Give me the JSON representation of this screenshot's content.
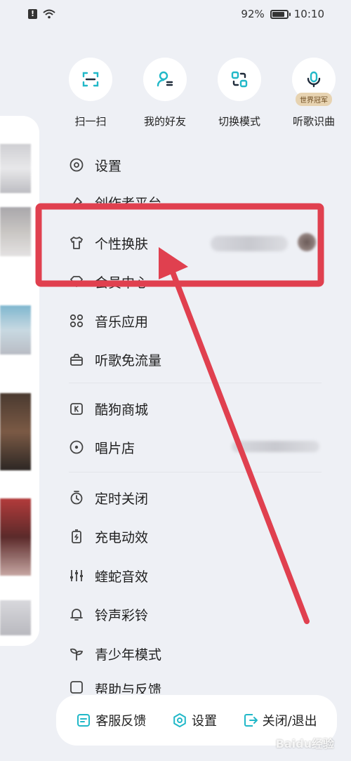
{
  "status_bar": {
    "battery": "92%",
    "time": "10:10"
  },
  "quick_actions": [
    {
      "label": "扫一扫",
      "icon": "scan-icon"
    },
    {
      "label": "我的好友",
      "icon": "friends-icon"
    },
    {
      "label": "切换模式",
      "icon": "switch-mode-icon"
    },
    {
      "label": "听歌识曲",
      "icon": "music-recognition-icon",
      "badge": "世界冠军"
    }
  ],
  "menu": {
    "settings": "设置",
    "creator_platform": "创作者平台",
    "skin": "个性换肤",
    "vip_center": "会员中心",
    "music_apps": "音乐应用",
    "free_data": "听歌免流量",
    "mall": "酷狗商城",
    "record_store": "唱片店",
    "sleep_timer": "定时关闭",
    "charge_effect": "充电动效",
    "viper_sound": "蝰蛇音效",
    "ringtone": "铃声彩铃",
    "teen_mode": "青少年模式",
    "help_feedback": "帮助与反馈"
  },
  "bottom_bar": {
    "service": "客服反馈",
    "settings": "设置",
    "close_exit": "关闭/退出"
  },
  "colors": {
    "accent": "#21b8c8",
    "annotation": "#e0404f",
    "background": "#eef0f5"
  },
  "watermark": "Baidu经验"
}
